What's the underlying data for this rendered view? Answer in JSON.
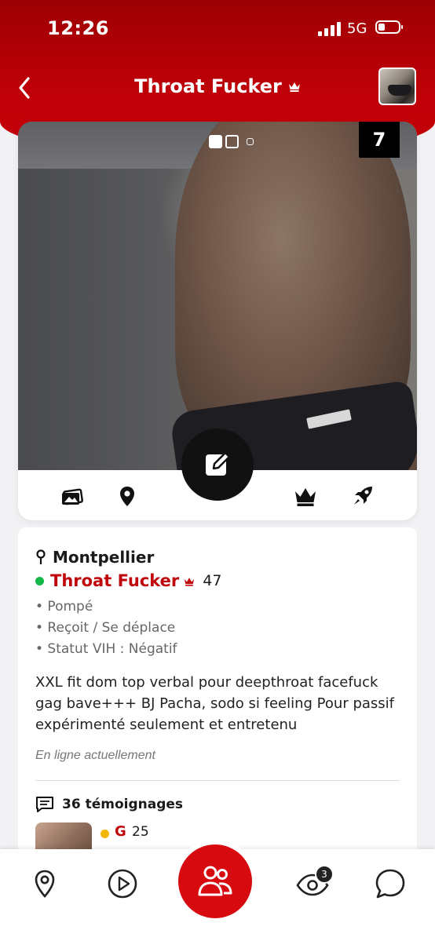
{
  "status_bar": {
    "time": "12:26",
    "network": "5G"
  },
  "header": {
    "title": "Throat Fucker",
    "back_icon": "chevron-left-icon",
    "title_badge_icon": "crown-icon"
  },
  "photo": {
    "count": "7",
    "current_index": 1,
    "total_dots": 3
  },
  "actions": {
    "icons": [
      "photos-icon",
      "location-pin-icon",
      "edit-icon",
      "crown-icon",
      "rocket-icon"
    ]
  },
  "profile": {
    "city": "Montpellier",
    "name": "Throat Fucker",
    "age": "47",
    "attributes": [
      "• Pompé",
      "• Reçoit / Se déplace",
      "• Statut VIH : Négatif"
    ],
    "bio": "XXL fit dom top verbal pour deepthroat facefuck gag bave+++ BJ Pacha, sodo si feeling Pour passif expérimenté seulement et entretenu",
    "online_status": "En ligne actuellement"
  },
  "reviews": {
    "title": "36 témoignages",
    "first": {
      "letter": "G",
      "age": "25"
    }
  },
  "tab_bar": {
    "tabs": [
      "map-pin-icon",
      "play-icon",
      "users-icon",
      "eye-icon",
      "chat-icon"
    ],
    "eye_badge": "3"
  },
  "colors": {
    "brand_red": "#c0070c",
    "online_green": "#14b84a"
  }
}
